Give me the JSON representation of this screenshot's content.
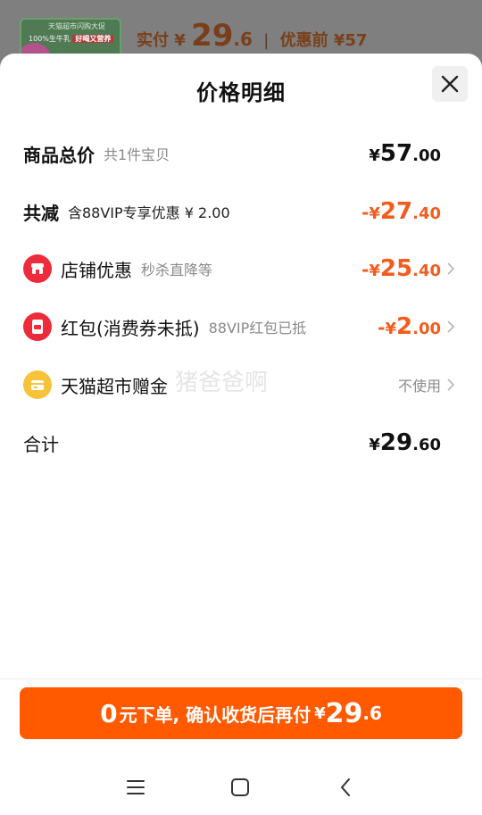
{
  "background": {
    "thumb_line1": "天猫超市闪购大促",
    "thumb_line2_prefix": "100%生牛乳",
    "thumb_line2_tag": "好喝又营养",
    "paid_label": "实付",
    "paid_yen": "¥",
    "paid_int": "29",
    "paid_dec": ".6",
    "separator": "|",
    "before_discount": "优惠前 ¥57"
  },
  "sheet": {
    "title": "价格明细",
    "close_icon": "close-icon"
  },
  "rows": {
    "total": {
      "label": "商品总价",
      "sub": "共1件宝贝",
      "yen": "¥",
      "int": "57",
      "dec": ".00"
    },
    "reduce": {
      "label": "共减",
      "sub": "含88VIP专享优惠 ¥ 2.00",
      "minus": "-",
      "yen": "¥",
      "int": "27",
      "dec": ".40"
    },
    "store": {
      "icon": "store-icon",
      "label": "店铺优惠",
      "sub": "秒杀直降等",
      "minus": "-",
      "yen": "¥",
      "int": "25",
      "dec": ".40"
    },
    "redpacket": {
      "icon": "red-packet-icon",
      "label": "红包(消费券未抵)",
      "sub": "88VIP红包已抵",
      "minus": "-",
      "yen": "¥",
      "int": "2",
      "dec": ".00"
    },
    "gift": {
      "icon": "gift-card-icon",
      "label": "天猫超市赠金",
      "value": "不使用"
    },
    "sum": {
      "label": "合计",
      "yen": "¥",
      "int": "29",
      "dec": ".60"
    }
  },
  "watermark": "猪爸爸啊",
  "cta": {
    "zero": "0",
    "text": "元下单, 确认收货后再付",
    "yen": "¥",
    "int": "29",
    "dec": ".6"
  },
  "nav": {
    "menu": "menu-icon",
    "home": "home-icon",
    "back": "back-icon"
  },
  "colors": {
    "accent": "#ff5a00",
    "discount": "#f25c1e",
    "red_icon": "#ee2b3b",
    "gold_icon": "#f6c33b"
  }
}
